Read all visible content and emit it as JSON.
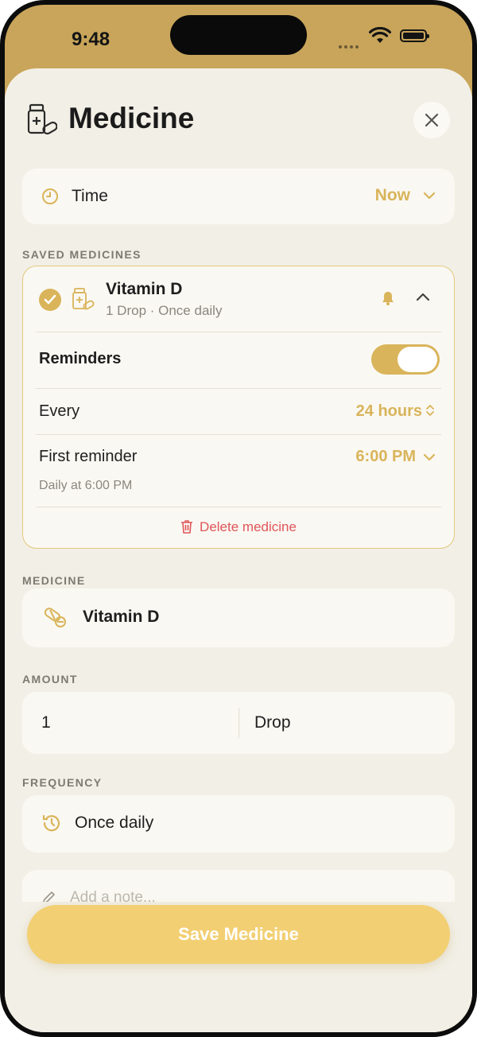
{
  "status_bar": {
    "time": "9:48"
  },
  "header": {
    "title": "Medicine",
    "icon": "medicine-bottle-icon",
    "close_icon": "close-icon"
  },
  "time_field": {
    "label": "Time",
    "value": "Now"
  },
  "saved_section": {
    "label": "SAVED MEDICINES",
    "items": [
      {
        "name": "Vitamin D",
        "subtitle": "1 Drop · Once daily",
        "selected": true,
        "reminders": {
          "label": "Reminders",
          "enabled": true,
          "every_label": "Every",
          "every_value": "24 hours",
          "first_label": "First reminder",
          "first_value": "6:00 PM",
          "summary": "Daily at 6:00 PM"
        },
        "delete_label": "Delete medicine"
      }
    ]
  },
  "medicine_section": {
    "label": "MEDICINE",
    "value": "Vitamin D"
  },
  "amount_section": {
    "label": "AMOUNT",
    "quantity": "1",
    "unit": "Drop"
  },
  "frequency_section": {
    "label": "FREQUENCY",
    "value": "Once daily"
  },
  "note": {
    "placeholder": "Add a note..."
  },
  "save_button": {
    "label": "Save Medicine"
  },
  "colors": {
    "accent": "#d9b45a",
    "sheet_bg": "#f2efe6",
    "danger": "#e0555a",
    "button": "#f2cf72"
  }
}
